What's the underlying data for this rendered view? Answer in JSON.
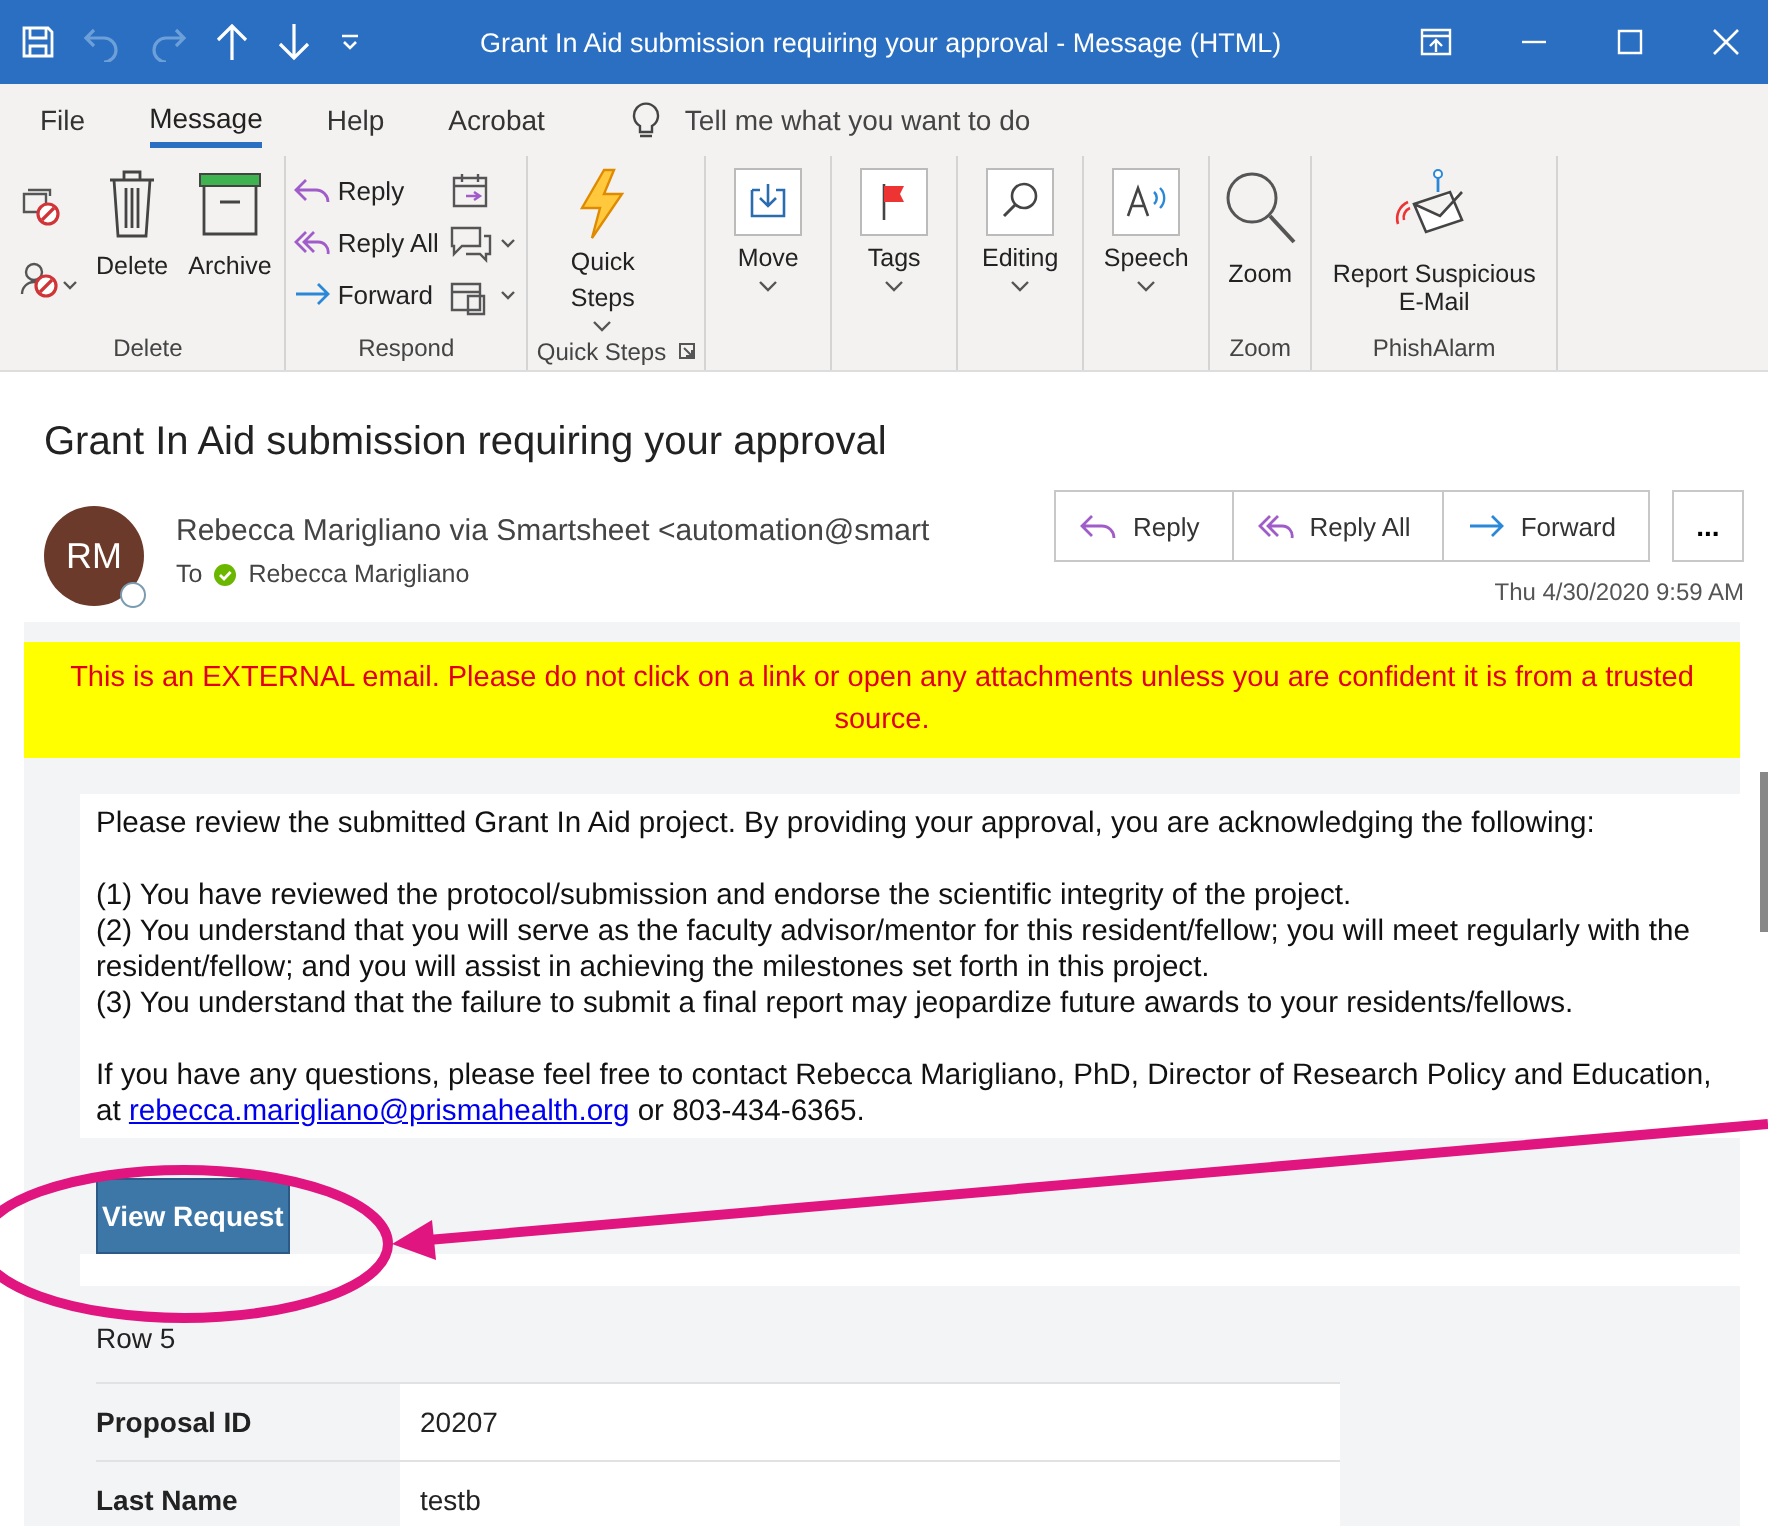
{
  "window": {
    "title": "Grant In Aid submission requiring your approval  -  Message (HTML)"
  },
  "menu_tabs": [
    {
      "label": "File",
      "selected": false
    },
    {
      "label": "Message",
      "selected": true
    },
    {
      "label": "Help",
      "selected": false
    },
    {
      "label": "Acrobat",
      "selected": false
    }
  ],
  "tell_me": {
    "placeholder": "Tell me what you want to do"
  },
  "ribbon_groups": [
    {
      "name": "Delete",
      "kind": "delete",
      "buttons": [
        "Delete",
        "Archive"
      ]
    },
    {
      "name": "Respond",
      "kind": "respond",
      "buttons": [
        "Reply",
        "Reply All",
        "Forward"
      ]
    },
    {
      "name": "Quick Steps",
      "kind": "quicksteps",
      "buttons": [
        "Quick Steps"
      ]
    },
    {
      "kind": "dropdown",
      "buttons": [
        "Move"
      ]
    },
    {
      "kind": "dropdown",
      "buttons": [
        "Tags"
      ]
    },
    {
      "kind": "dropdown",
      "buttons": [
        "Editing"
      ]
    },
    {
      "kind": "dropdown",
      "buttons": [
        "Speech"
      ]
    },
    {
      "name": "Zoom",
      "kind": "large",
      "buttons": [
        "Zoom"
      ]
    },
    {
      "name": "PhishAlarm",
      "kind": "large",
      "buttons": [
        "Report Suspicious E-Mail"
      ]
    }
  ],
  "message": {
    "subject": "Grant In Aid submission requiring your approval",
    "avatar_initials": "RM",
    "sender": "Rebecca Marigliano via Smartsheet <automation@smart",
    "to_label": "To",
    "recipient": "Rebecca Marigliano",
    "actions": [
      "Reply",
      "Reply All",
      "Forward"
    ],
    "more": "...",
    "date": "Thu 4/30/2020 9:59 AM"
  },
  "banner": "This is an EXTERNAL email. Please do not click on a link or open any attachments unless you are confident it is from a trusted source.",
  "body": {
    "intro": "Please review the submitted Grant In Aid project. By providing your approval, you are acknowledging the following:",
    "points": [
      "(1) You have reviewed the protocol/submission and endorse the scientific integrity of the project.",
      "(2) You understand that you will serve as the faculty advisor/mentor for this resident/fellow; you will meet regularly with the resident/fellow; and you will assist in achieving the milestones set forth in this project.",
      "(3) You understand that the failure to submit a final report may jeopardize future awards to your residents/fellows."
    ],
    "contact_before": "If you have any questions, please feel free to contact Rebecca Marigliano, PhD, Director of Research Policy and Education, at",
    "contact_link": "rebecca.marigliano@prismahealth.org",
    "contact_after": "or 803-434-6365.",
    "button": "View Request",
    "row_label": "Row 5",
    "fields": [
      {
        "label": "Proposal ID",
        "value": "20207"
      },
      {
        "label": "Last Name",
        "value": "testb"
      }
    ]
  }
}
